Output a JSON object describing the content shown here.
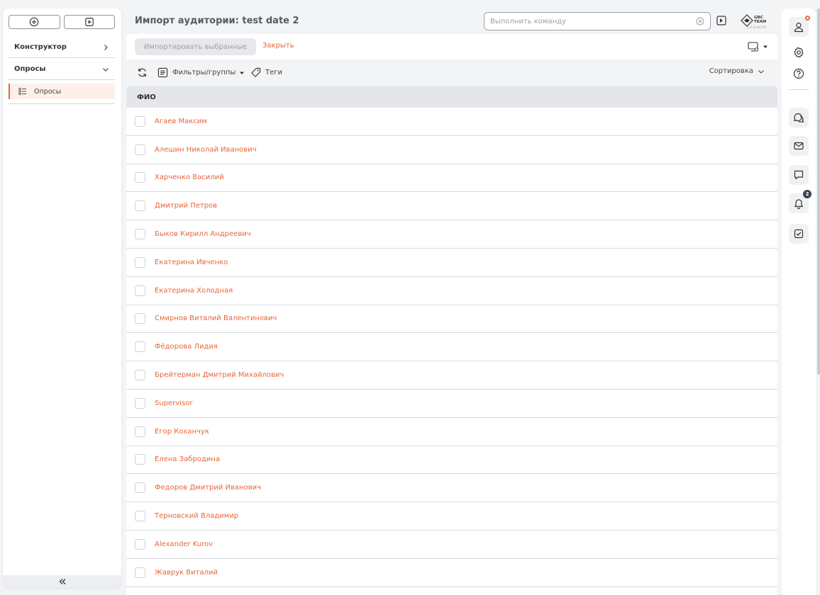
{
  "sidebar": {
    "sections": [
      {
        "label": "Конструктор"
      },
      {
        "label": "Опросы"
      }
    ],
    "sub_item": {
      "label": "Опросы"
    }
  },
  "header": {
    "title": "Импорт аудитории: test date 2",
    "command_placeholder": "Выполнить команду",
    "logo_line1": "GBC",
    "logo_line2": "TEAM",
    "version": "1.5.0.14114"
  },
  "actions": {
    "import_label": "Импортировать выбранные",
    "close_label": "Закрыть"
  },
  "toolbar": {
    "filters_label": "Фильтры/группы",
    "tags_label": "Теги",
    "sort_label": "Сортировка"
  },
  "table": {
    "header": "ФИО",
    "rows": [
      "Агаев Максим",
      "Алешин Николай Иванович",
      "Харченко Василий",
      "Дмитрий Петров",
      "Быков Кирилл Андреевич",
      "Екатерина Ивченко",
      "Екатерина Холодная",
      "Смирнов Виталий Валентинович",
      "Фёдорова Лидия",
      "Брейтерман Дмитрий Михайлович",
      "Supervisor",
      "Егор Коханчук",
      "Елена Забродина",
      "Федоров Дмитрий Иванович",
      "Терновский Владимир",
      "Alexander Kurov",
      "Жаврук Виталий"
    ]
  },
  "rail": {
    "notifications_count": "2"
  },
  "colors": {
    "accent": "#e8663a",
    "sidebar_active_bg": "#fdf0ea",
    "table_header_bg": "#e4e6e9"
  },
  "icons": [
    "plus-circle-icon",
    "play-icon",
    "chevron-right-icon",
    "chevron-down-icon",
    "list-icon",
    "double-chevron-left-icon",
    "clear-icon",
    "run-command-icon",
    "monitor-settings-icon",
    "refresh-icon",
    "filter-list-icon",
    "tag-icon",
    "user-icon",
    "gear-icon",
    "help-icon",
    "chats-icon",
    "mail-icon",
    "chat-icon",
    "bell-icon",
    "task-check-icon"
  ]
}
